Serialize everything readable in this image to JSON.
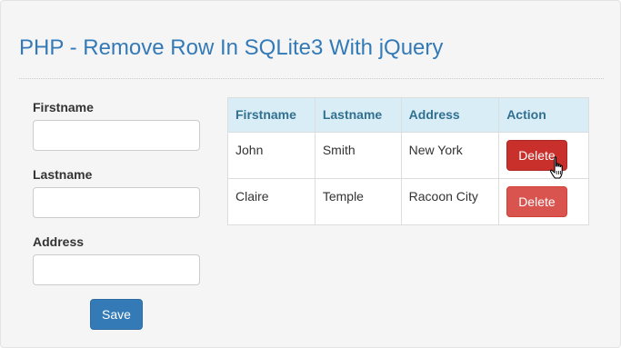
{
  "page": {
    "title": "PHP - Remove Row In SQLite3 With jQuery"
  },
  "form": {
    "firstname_label": "Firstname",
    "lastname_label": "Lastname",
    "address_label": "Address",
    "firstname_value": "",
    "lastname_value": "",
    "address_value": "",
    "save_label": "Save"
  },
  "table": {
    "headers": [
      "Firstname",
      "Lastname",
      "Address",
      "Action"
    ],
    "rows": [
      {
        "firstname": "John",
        "lastname": "Smith",
        "address": "New York",
        "action_label": "Delete"
      },
      {
        "firstname": "Claire",
        "lastname": "Temple",
        "address": "Racoon City",
        "action_label": "Delete"
      }
    ]
  },
  "colors": {
    "title": "#337ab7",
    "primary_button": "#337ab7",
    "danger_button": "#d9534f",
    "danger_button_hover": "#c9302c",
    "table_header_bg": "#d9edf7",
    "table_header_text": "#31708f"
  },
  "icons": {
    "cursor": "hand-pointer-icon"
  }
}
